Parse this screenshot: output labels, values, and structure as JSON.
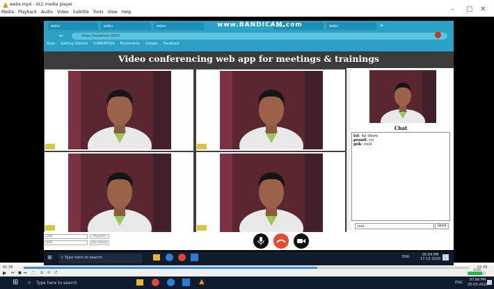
{
  "vlc": {
    "title": "webx.mp4 - VLC media player",
    "menu": [
      "Media",
      "Playback",
      "Audio",
      "Video",
      "Subtitle",
      "Tools",
      "View",
      "Help"
    ],
    "time_elapsed": "01:38",
    "time_total": "02:39",
    "progress": 0.66,
    "volume": "110%"
  },
  "browser": {
    "tabs": [
      "webx",
      "webx",
      "webx",
      "webx",
      "webx"
    ],
    "url": "https://localhost:3003",
    "bookmarks": [
      "Apps",
      "Getting Started",
      "S-WIKIPEDIA",
      "Bookmarks",
      "Google",
      "Facebook"
    ],
    "watermark": "www.BANDICAM.com"
  },
  "app": {
    "title": "Video conferencing web app for meetings & trainings"
  },
  "chat": {
    "title": "Chat",
    "messages": [
      {
        "user": "lol",
        "text": "hii there"
      },
      {
        "user": "pranit",
        "text": "yo"
      },
      {
        "user": "gok",
        "text": "cool"
      }
    ],
    "input_value": "cool",
    "send_label": "Send"
  },
  "join": {
    "name_value": "yolt",
    "room_value": "xxx",
    "register_label": "Register",
    "join_label": "Join Room"
  },
  "inner_taskbar": {
    "search_placeholder": "Type here to search",
    "time": "05:04 PM",
    "date": "17-12-2020",
    "lang": "ENG"
  },
  "taskbar": {
    "search_placeholder": "Type here to search",
    "time": "07:06 PM",
    "date": "25-03-2021",
    "lang": "ENG"
  },
  "colors": {
    "browser_accent": "#2aa1c5",
    "header": "#3c3c3c",
    "end_call": "#e8492f",
    "taskbar": "#0f1b2e",
    "vlc_progress": "#3a8fdc"
  }
}
